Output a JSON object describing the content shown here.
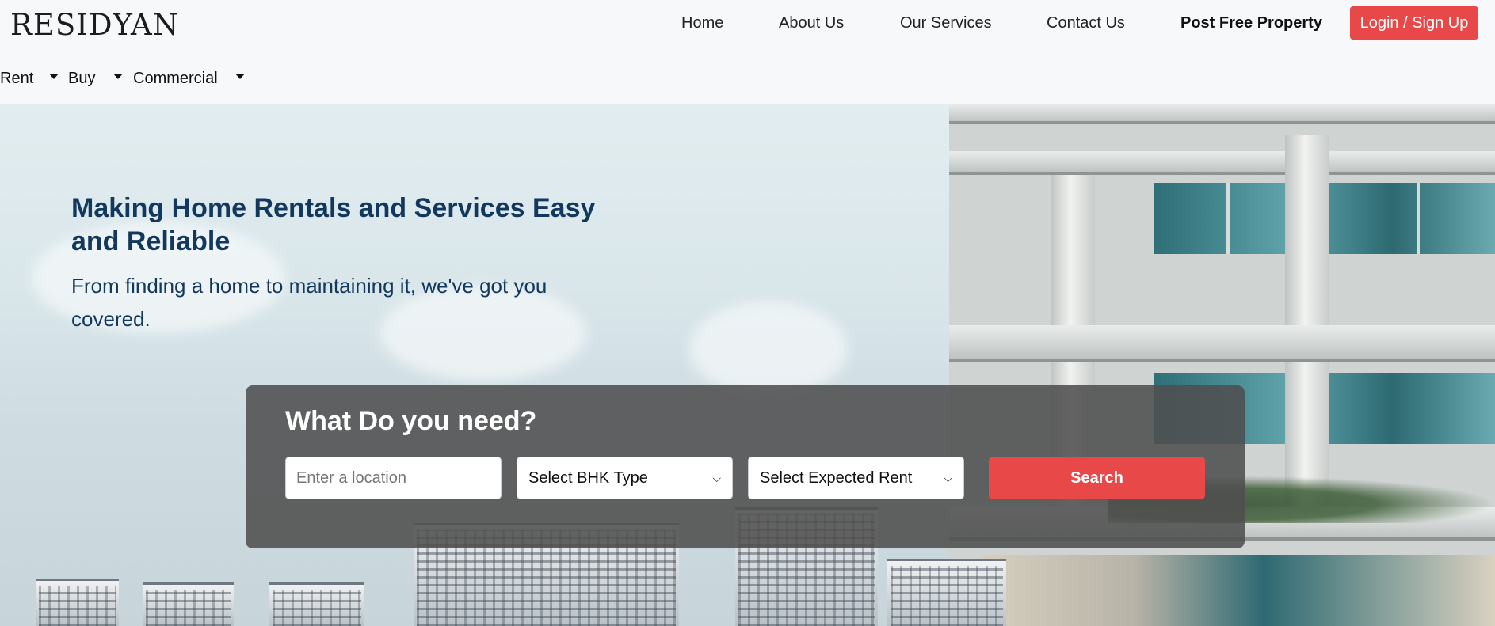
{
  "brand": {
    "logo_text": "RESIDYAN"
  },
  "nav": {
    "links": [
      "Home",
      "About Us",
      "Our Services",
      "Contact Us"
    ],
    "post_property": "Post Free Property",
    "login": "Login / Sign Up"
  },
  "subnav": {
    "items": [
      "Rent",
      "Buy",
      "Commercial"
    ]
  },
  "hero": {
    "title": "Making Home Rentals and Services Easy and Reliable",
    "subtitle": "From finding a home to maintaining it, we've got you covered."
  },
  "search": {
    "heading": "What Do you need?",
    "location_placeholder": "Enter a location",
    "bhk_selected": "Select BHK Type",
    "rent_selected": "Select Expected Rent",
    "button": "Search"
  },
  "colors": {
    "accent": "#e84848",
    "heading": "#12385e",
    "panel": "#4e4e4e"
  }
}
